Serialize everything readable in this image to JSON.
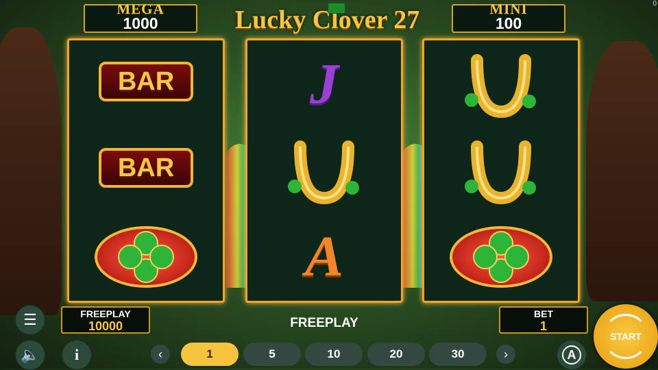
{
  "title": "Lucky Clover 27",
  "jackpots": {
    "mega_label": "MEGA",
    "mega_value": "1000",
    "mini_label": "MINI",
    "mini_value": "100"
  },
  "corner_value": "0",
  "reels": [
    {
      "symbols": [
        "BAR",
        "BAR",
        "clover"
      ]
    },
    {
      "symbols": [
        "J",
        "horseshoe",
        "A"
      ]
    },
    {
      "symbols": [
        "horseshoe",
        "horseshoe",
        "clover"
      ]
    }
  ],
  "freeplay_box": {
    "label": "FREEPLAY",
    "value": "10000"
  },
  "mode_label": "FREEPLAY",
  "bet_box": {
    "label": "BET",
    "value": "1"
  },
  "stakes": [
    "1",
    "5",
    "10",
    "20",
    "30"
  ],
  "selected_stake": "1",
  "start_label": "START",
  "colors": {
    "gold": "#f6c53b",
    "reel_border": "#f0a52a",
    "start": "#f2b12a"
  },
  "icons": [
    "menu-icon",
    "speaker-icon",
    "info-icon",
    "chevron-left-icon",
    "chevron-right-icon",
    "autoplay-icon",
    "clover-icon",
    "horseshoe-icon",
    "hat-icon"
  ]
}
